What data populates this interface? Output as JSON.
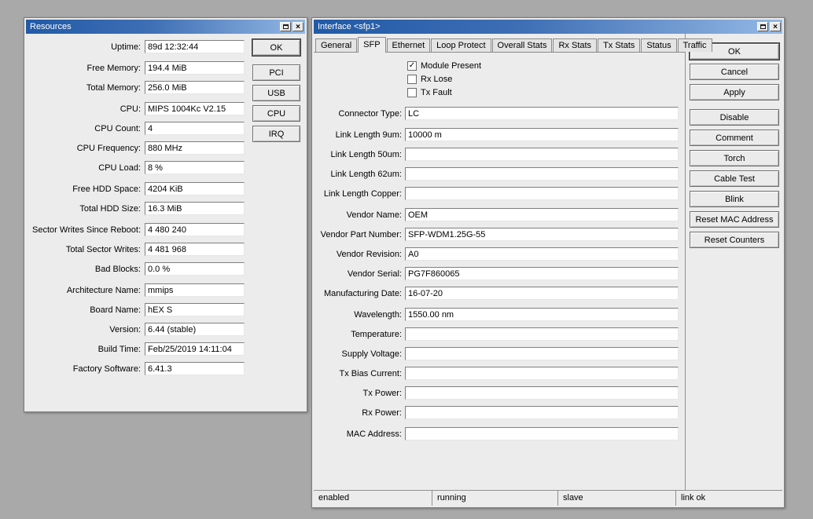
{
  "icons": {
    "close": "×",
    "check": "✓"
  },
  "colors": {
    "desktop_bg": "#a9a9a9",
    "window_bg": "#ececec",
    "titlebar_left": "#215aa6",
    "titlebar_right": "#93b8e4"
  },
  "resources": {
    "title": "Resources",
    "fields": [
      {
        "label": "Uptime:",
        "value": "89d 12:32:44"
      },
      {
        "label": "Free Memory:",
        "value": "194.4 MiB"
      },
      {
        "label": "Total Memory:",
        "value": "256.0 MiB"
      },
      {
        "label": "CPU:",
        "value": "MIPS 1004Kc V2.15"
      },
      {
        "label": "CPU Count:",
        "value": "4"
      },
      {
        "label": "CPU Frequency:",
        "value": "880 MHz"
      },
      {
        "label": "CPU Load:",
        "value": "8 %"
      },
      {
        "label": "Free HDD Space:",
        "value": "4204 KiB"
      },
      {
        "label": "Total HDD Size:",
        "value": "16.3 MiB"
      },
      {
        "label": "Sector Writes Since Reboot:",
        "value": "4 480 240"
      },
      {
        "label": "Total Sector Writes:",
        "value": "4 481 968"
      },
      {
        "label": "Bad Blocks:",
        "value": "0.0 %"
      },
      {
        "label": "Architecture Name:",
        "value": "mmips"
      },
      {
        "label": "Board Name:",
        "value": "hEX S"
      },
      {
        "label": "Version:",
        "value": "6.44 (stable)"
      },
      {
        "label": "Build Time:",
        "value": "Feb/25/2019 14:11:04"
      },
      {
        "label": "Factory Software:",
        "value": "6.41.3"
      }
    ],
    "side_buttons": [
      "OK",
      "PCI",
      "USB",
      "CPU",
      "IRQ"
    ]
  },
  "iface": {
    "title": "Interface <sfp1>",
    "tabs": [
      {
        "label": "General",
        "active": false
      },
      {
        "label": "SFP",
        "active": true
      },
      {
        "label": "Ethernet",
        "active": false
      },
      {
        "label": "Loop Protect",
        "active": false
      },
      {
        "label": "Overall Stats",
        "active": false
      },
      {
        "label": "Rx Stats",
        "active": false
      },
      {
        "label": "Tx Stats",
        "active": false
      },
      {
        "label": "Status",
        "active": false
      },
      {
        "label": "Traffic",
        "active": false
      }
    ],
    "checkboxes": [
      {
        "label": "Module Present",
        "checked": true
      },
      {
        "label": "Rx Lose",
        "checked": false
      },
      {
        "label": "Tx Fault",
        "checked": false
      }
    ],
    "fields": [
      {
        "label": "Connector Type:",
        "value": "LC"
      },
      {
        "label": "Link Length 9um:",
        "value": "10000 m"
      },
      {
        "label": "Link Length 50um:",
        "value": ""
      },
      {
        "label": "Link Length 62um:",
        "value": ""
      },
      {
        "label": "Link Length Copper:",
        "value": ""
      },
      {
        "label": "Vendor Name:",
        "value": "OEM"
      },
      {
        "label": "Vendor Part Number:",
        "value": "SFP-WDM1.25G-55"
      },
      {
        "label": "Vendor Revision:",
        "value": "A0"
      },
      {
        "label": "Vendor Serial:",
        "value": "PG7F860065"
      },
      {
        "label": "Manufacturing Date:",
        "value": "16-07-20"
      },
      {
        "label": "Wavelength:",
        "value": "1550.00 nm"
      },
      {
        "label": "Temperature:",
        "value": ""
      },
      {
        "label": "Supply Voltage:",
        "value": ""
      },
      {
        "label": "Tx Bias Current:",
        "value": ""
      },
      {
        "label": "Tx Power:",
        "value": ""
      },
      {
        "label": "Rx Power:",
        "value": ""
      },
      {
        "label": "MAC Address:",
        "value": ""
      }
    ],
    "side_buttons": [
      "OK",
      "Cancel",
      "Apply",
      "Disable",
      "Comment",
      "Torch",
      "Cable Test",
      "Blink",
      "Reset MAC Address",
      "Reset Counters"
    ],
    "status": [
      "enabled",
      "running",
      "slave",
      "link ok"
    ]
  }
}
